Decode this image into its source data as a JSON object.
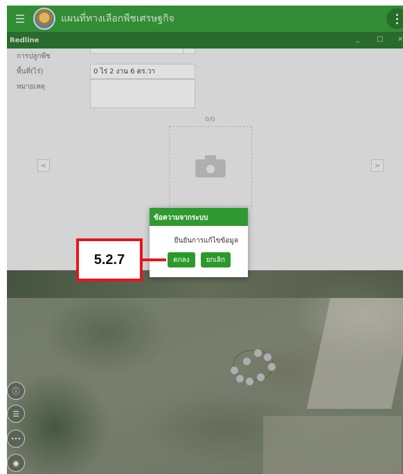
{
  "app": {
    "title": "แผนที่ทางเลือกพืชเศรษฐกิจ"
  },
  "redline": {
    "window_title": "Redline",
    "min_label": "_",
    "max_label": "□",
    "close_label": "×",
    "fields": [
      {
        "label": "การปลูกพืช",
        "value": ""
      },
      {
        "label": "พื้นที่(ไร่)",
        "value": "0 ไร่ 2 งาน 6 ตร.วา"
      },
      {
        "label": "หมายเหตุ",
        "value": ""
      }
    ],
    "photo_counter": "0/0",
    "prev_label": "<",
    "next_label": ">"
  },
  "dialog": {
    "title": "ข้อความจากระบบ",
    "message": "ยืนยันการแก้ไขข้อมูล",
    "ok_label": "ตกลง",
    "cancel_label": "ยกเลิก"
  },
  "annotation": {
    "step_label": "5.2.7"
  },
  "tools": [
    {
      "icon": "info-icon",
      "glyph": "ⓘ"
    },
    {
      "icon": "list-icon",
      "glyph": "☰"
    },
    {
      "icon": "more-icon",
      "glyph": "•••"
    },
    {
      "icon": "locate-icon",
      "glyph": "◉"
    }
  ],
  "colors": {
    "header_green": "#3aa13c",
    "window_bar_green": "#2f7a33",
    "dialog_green": "#2f9a2f",
    "callout_red": "#e8141b"
  }
}
